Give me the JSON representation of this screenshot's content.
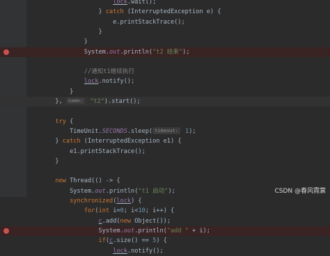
{
  "editor": {
    "lines": [
      {
        "gutter": "",
        "tokens": [
          [
            "                        ",
            ""
          ],
          [
            "lock",
            "fld ul"
          ],
          [
            ".wait();",
            ""
          ]
        ]
      },
      {
        "gutter": "",
        "tokens": [
          [
            "                    } ",
            ""
          ],
          [
            "catch",
            "kw"
          ],
          [
            " (InterruptedException e) {",
            ""
          ]
        ]
      },
      {
        "gutter": "",
        "tokens": [
          [
            "                        e.printStackTrace();",
            ""
          ]
        ]
      },
      {
        "gutter": "",
        "tokens": [
          [
            "                    }",
            ""
          ]
        ]
      },
      {
        "gutter": "",
        "tokens": [
          [
            "                }",
            ""
          ]
        ]
      },
      {
        "gutter": "breakpoint",
        "tokens": [
          [
            "                System.",
            ""
          ],
          [
            "out",
            "sfld"
          ],
          [
            ".println(",
            ""
          ],
          [
            "\"t2 结束\"",
            "str"
          ],
          [
            ");",
            ""
          ]
        ]
      },
      {
        "gutter": "",
        "tokens": [
          [
            "",
            ""
          ]
        ]
      },
      {
        "gutter": "",
        "tokens": [
          [
            "                ",
            ""
          ],
          [
            "//通知t1继续执行",
            "cmt"
          ]
        ]
      },
      {
        "gutter": "",
        "tokens": [
          [
            "                ",
            ""
          ],
          [
            "lock",
            "fld ul"
          ],
          [
            ".notify();",
            ""
          ]
        ]
      },
      {
        "gutter": "",
        "tokens": [
          [
            "            }",
            ""
          ]
        ]
      },
      {
        "gutter": "current",
        "tokens": [
          [
            "        }, ",
            ""
          ],
          [
            "name:",
            "hint"
          ],
          [
            " ",
            ""
          ],
          [
            "\"t2\"",
            "str"
          ],
          [
            ").start();",
            ""
          ]
        ]
      },
      {
        "gutter": "",
        "tokens": [
          [
            "",
            ""
          ]
        ]
      },
      {
        "gutter": "",
        "tokens": [
          [
            "        ",
            ""
          ],
          [
            "try",
            "kw"
          ],
          [
            " {",
            ""
          ]
        ]
      },
      {
        "gutter": "",
        "tokens": [
          [
            "            TimeUnit.",
            ""
          ],
          [
            "SECONDS",
            "sfld"
          ],
          [
            ".sleep(",
            ""
          ],
          [
            "timeout:",
            "hint"
          ],
          [
            " ",
            ""
          ],
          [
            "1",
            "num"
          ],
          [
            ");",
            ""
          ]
        ]
      },
      {
        "gutter": "",
        "tokens": [
          [
            "        } ",
            ""
          ],
          [
            "catch",
            "kw"
          ],
          [
            " (InterruptedException e1) {",
            ""
          ]
        ]
      },
      {
        "gutter": "",
        "tokens": [
          [
            "            e1.printStackTrace();",
            ""
          ]
        ]
      },
      {
        "gutter": "",
        "tokens": [
          [
            "        }",
            ""
          ]
        ]
      },
      {
        "gutter": "",
        "tokens": [
          [
            "",
            ""
          ]
        ]
      },
      {
        "gutter": "",
        "tokens": [
          [
            "        ",
            ""
          ],
          [
            "new",
            "kw"
          ],
          [
            " Thread(() -> {",
            ""
          ]
        ]
      },
      {
        "gutter": "",
        "tokens": [
          [
            "            System.",
            ""
          ],
          [
            "out",
            "sfld"
          ],
          [
            ".println(",
            ""
          ],
          [
            "\"t1 启动\"",
            "str"
          ],
          [
            ");",
            ""
          ]
        ]
      },
      {
        "gutter": "",
        "tokens": [
          [
            "            ",
            ""
          ],
          [
            "synchronized",
            "kw"
          ],
          [
            "(",
            ""
          ],
          [
            "lock",
            "fld ul"
          ],
          [
            ") {",
            ""
          ]
        ]
      },
      {
        "gutter": "",
        "tokens": [
          [
            "                ",
            ""
          ],
          [
            "for",
            "kw"
          ],
          [
            "(",
            ""
          ],
          [
            "int",
            "kw"
          ],
          [
            " i=",
            ""
          ],
          [
            "0",
            "num"
          ],
          [
            "; i<",
            ""
          ],
          [
            "10",
            "num"
          ],
          [
            "; i++) {",
            ""
          ]
        ]
      },
      {
        "gutter": "",
        "tokens": [
          [
            "                    ",
            ""
          ],
          [
            "c",
            "fld ul"
          ],
          [
            ".add(",
            ""
          ],
          [
            "new",
            "kw"
          ],
          [
            " Object());",
            ""
          ]
        ]
      },
      {
        "gutter": "breakpoint",
        "tokens": [
          [
            "                    System.",
            ""
          ],
          [
            "out",
            "sfld"
          ],
          [
            ".println(",
            ""
          ],
          [
            "\"add \"",
            "str"
          ],
          [
            " + i);",
            ""
          ]
        ]
      },
      {
        "gutter": "",
        "tokens": [
          [
            "                    ",
            ""
          ],
          [
            "if",
            "kw"
          ],
          [
            "(",
            ""
          ],
          [
            "c",
            "fld ul"
          ],
          [
            ".size() == ",
            ""
          ],
          [
            "5",
            "num"
          ],
          [
            ") {",
            ""
          ]
        ]
      },
      {
        "gutter": "",
        "tokens": [
          [
            "                        ",
            ""
          ],
          [
            "lock",
            "fld ul"
          ],
          [
            ".notify();",
            ""
          ]
        ]
      }
    ]
  },
  "watermark": "CSDN @春风霓裳",
  "colors": {
    "background": "#2b2b2b",
    "gutter": "#313335",
    "keyword": "#cc7832",
    "string": "#6a8759",
    "field": "#9876aa",
    "number": "#6897bb",
    "comment": "#808080",
    "breakpoint": "#c75450"
  }
}
